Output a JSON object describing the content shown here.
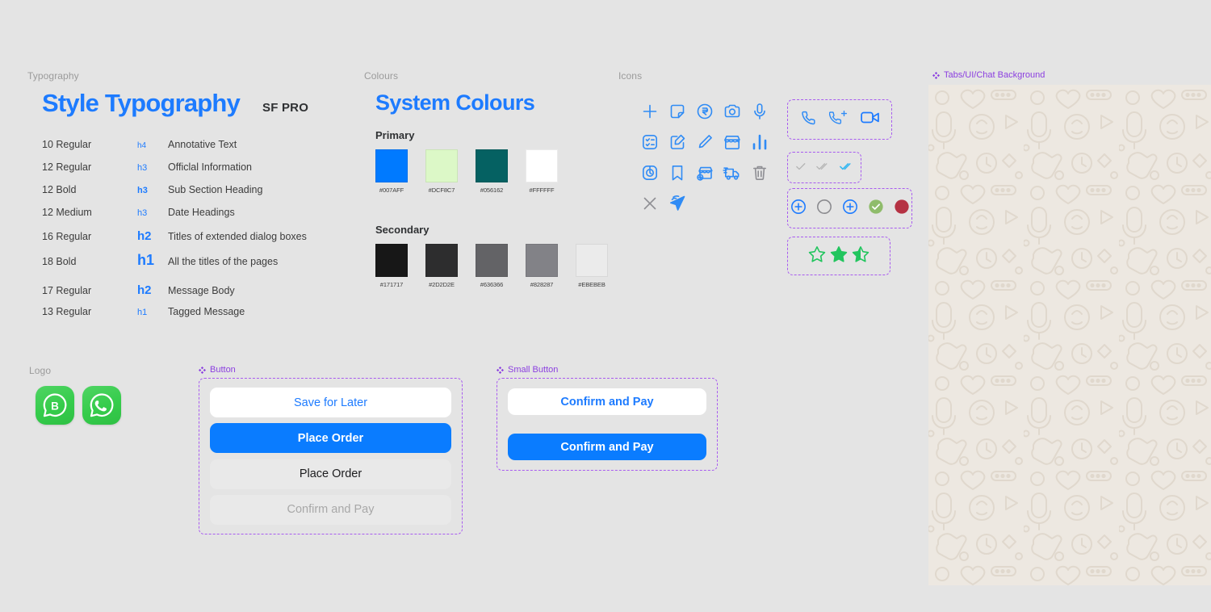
{
  "sections": {
    "typography_label": "Typography",
    "colours_label": "Colours",
    "icons_label": "Icons",
    "logo_label": "Logo"
  },
  "typography": {
    "title": "Style Typography",
    "font_name": "SF PRO",
    "rows": [
      {
        "size": "10 Regular",
        "tag": "h4",
        "tag_style": "h4",
        "desc": "Annotative Text"
      },
      {
        "size": "12 Regular",
        "tag": "h3",
        "tag_style": "h3",
        "desc": "Officlal Information"
      },
      {
        "size": "12 Bold",
        "tag": "h3",
        "tag_style": "h3b",
        "desc": "Sub Section Heading"
      },
      {
        "size": "12 Medium",
        "tag": "h3",
        "tag_style": "h3",
        "desc": "Date Headings"
      },
      {
        "size": "16 Regular",
        "tag": "h2",
        "tag_style": "h2",
        "desc": "Titles of extended dialog boxes"
      },
      {
        "size": "18 Bold",
        "tag": "h1",
        "tag_style": "h1",
        "desc": "All the titles of the pages"
      },
      {
        "size": "17 Regular",
        "tag": "h2",
        "tag_style": "h2",
        "desc": "Message Body"
      },
      {
        "size": "13 Regular",
        "tag": "h1",
        "tag_style": "h1s",
        "desc": "Tagged Message"
      }
    ]
  },
  "colours": {
    "title": "System Colours",
    "primary_label": "Primary",
    "secondary_label": "Secondary",
    "primary": [
      {
        "hex": "#007AFF",
        "label": "#007AFF"
      },
      {
        "hex": "#DCF8C7",
        "label": "#DCF8C7"
      },
      {
        "hex": "#056162",
        "label": "#056162"
      },
      {
        "hex": "#FFFFFF",
        "label": "#FFFFFF"
      }
    ],
    "secondary": [
      {
        "hex": "#171717",
        "label": "#171717"
      },
      {
        "hex": "#2D2D2E",
        "label": "#2D2D2E"
      },
      {
        "hex": "#636366",
        "label": "#636366"
      },
      {
        "hex": "#828287",
        "label": "#828287"
      },
      {
        "hex": "#EBEBEB",
        "label": "#EBEBEB"
      }
    ]
  },
  "icons": {
    "accent": "#2F8BF5",
    "grey": "#8E8E93",
    "grid": [
      "plus-icon",
      "sticky-note-icon",
      "rupee-circle-icon",
      "camera-icon",
      "microphone-icon",
      "checklist-icon",
      "edit-square-icon",
      "pencil-icon",
      "store-icon",
      "bar-chart-icon",
      "timer-icon",
      "bookmark-icon",
      "store-add-icon",
      "delivery-truck-icon",
      "trash-icon",
      "close-icon",
      "send-icon"
    ]
  },
  "components": {
    "call_frame": {
      "icons": [
        "phone-icon",
        "phone-add-icon",
        "video-camera-icon"
      ]
    },
    "ticks_frame": {
      "icons": [
        "single-check-icon",
        "double-check-icon",
        "double-check-read-icon"
      ]
    },
    "status_frame": {
      "icons": [
        "plus-circle-icon",
        "empty-circle-icon",
        "plus-circle-icon",
        "check-circle-green-icon",
        "filled-circle-red-icon"
      ]
    },
    "stars_frame": {
      "icons": [
        "star-empty-icon",
        "star-full-icon",
        "star-half-icon"
      ]
    },
    "chat_background": {
      "label": "Tabs/UI/Chat Background"
    },
    "button_group": {
      "label": "Button",
      "buttons": [
        {
          "text": "Save for Later",
          "variant": "white"
        },
        {
          "text": "Place Order",
          "variant": "blue"
        },
        {
          "text": "Place Order",
          "variant": "grey"
        },
        {
          "text": "Confirm and Pay",
          "variant": "disabled"
        }
      ]
    },
    "small_button_group": {
      "label": "Small Button",
      "buttons": [
        {
          "text": "Confirm and Pay",
          "variant": "white"
        },
        {
          "text": "Confirm and Pay",
          "variant": "blue"
        }
      ]
    }
  },
  "logo": {
    "tiles": [
      {
        "name": "whatsapp-business-logo",
        "glyph": "B"
      },
      {
        "name": "whatsapp-logo",
        "glyph": "phone"
      }
    ]
  }
}
